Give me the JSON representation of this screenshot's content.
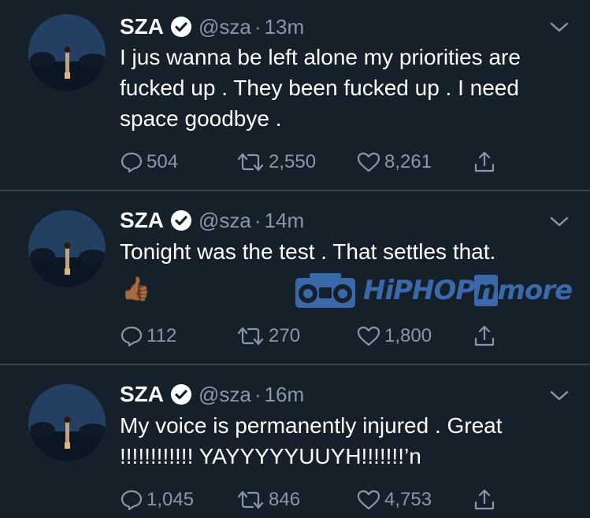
{
  "tweets": [
    {
      "name": "SZA",
      "handle": "@sza",
      "time": "13m",
      "text": "I jus wanna be left alone my priorities are fucked up . They been fucked up . I need space goodbye .",
      "emoji": "",
      "replies": "504",
      "retweets": "2,550",
      "likes": "8,261"
    },
    {
      "name": "SZA",
      "handle": "@sza",
      "time": "14m",
      "text": "Tonight was the test . That settles that.",
      "emoji": "👍🏾",
      "replies": "112",
      "retweets": "270",
      "likes": "1,800"
    },
    {
      "name": "SZA",
      "handle": "@sza",
      "time": "16m",
      "text": "My voice is permanently injured . Great !!!!!!!!!!!! YAYYYYYUUYH!!!!!!!’n",
      "emoji": "",
      "replies": "1,045",
      "retweets": "846",
      "likes": "4,753"
    }
  ],
  "watermark": {
    "prefix": "HiPHOP",
    "n": "n",
    "suffix": "more"
  },
  "colors": {
    "background": "#16202b",
    "muted": "#8899a6",
    "divider": "#3a4451",
    "watermark": "#3b68a8"
  },
  "icons": [
    "verified-badge-icon",
    "chevron-down-icon",
    "reply-icon",
    "retweet-icon",
    "like-icon",
    "share-icon",
    "boombox-icon"
  ]
}
